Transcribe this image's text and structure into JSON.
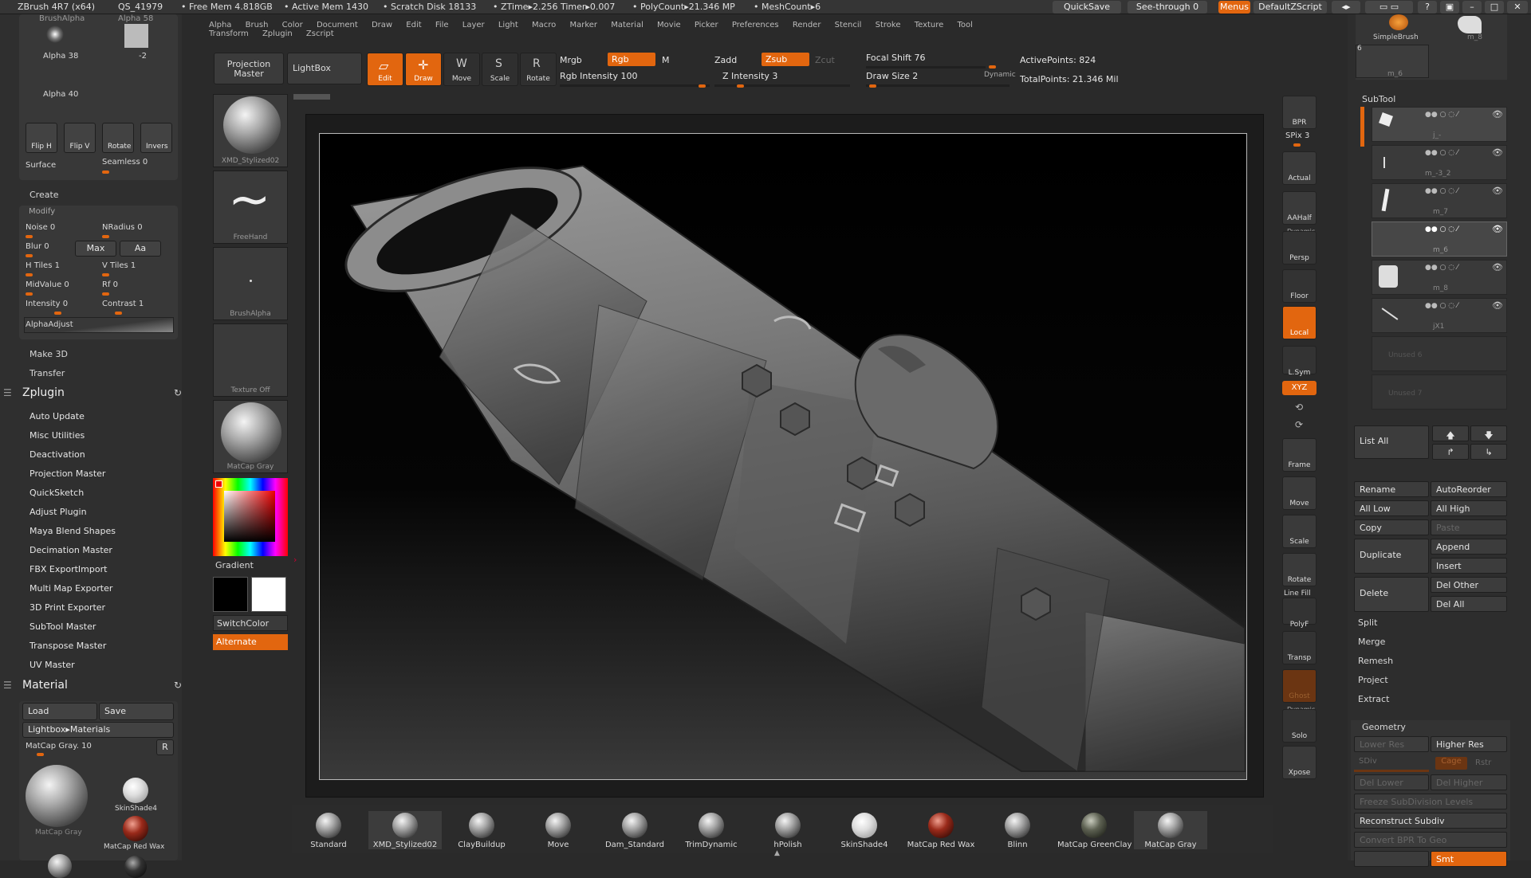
{
  "titlebar": {
    "app": "ZBrush 4R7 (x64)",
    "qs": "QS_41979",
    "free_mem": "• Free Mem 4.818GB",
    "active_mem": "• Active Mem 1430",
    "scratch": "• Scratch Disk 18133",
    "ztime": "• ZTime▸2.256 Timer▸0.007",
    "polycount": "• PolyCount▸21.346 MP",
    "meshcount": "• MeshCount▸6",
    "quicksave": "QuickSave",
    "see_through": "See-through  0",
    "menus": "Menus",
    "default_zscript": "DefaultZScript"
  },
  "menubar": [
    "Alpha",
    "Brush",
    "Color",
    "Document",
    "Draw",
    "Edit",
    "File",
    "Layer",
    "Light",
    "Macro",
    "Marker",
    "Material",
    "Movie",
    "Picker",
    "Preferences",
    "Render",
    "Stencil",
    "Stroke",
    "Texture",
    "Tool",
    "Transform",
    "Zplugin",
    "Zscript"
  ],
  "toolbar": {
    "projection_master": "Projection Master",
    "lightbox": "LightBox",
    "edit": "Edit",
    "draw": "Draw",
    "move": "Move",
    "scale": "Scale",
    "rotate": "Rotate",
    "mrgb": "Mrgb",
    "rgb": "Rgb",
    "m": "M",
    "rgb_intensity": "Rgb Intensity 100",
    "zadd": "Zadd",
    "zsub": "Zsub",
    "zcut": "Zcut",
    "z_intensity": "Z Intensity 3",
    "focal_shift": "Focal Shift 76",
    "draw_size": "Draw Size 2",
    "dynamic": "Dynamic",
    "active_points": "ActivePoints: 824",
    "total_points": "TotalPoints: 21.346 Mil"
  },
  "alpha_panel": {
    "brush_alpha": "BrushAlpha",
    "alpha58": "Alpha 58",
    "alpha38": "Alpha 38",
    "neg2": "-2",
    "alpha40": "Alpha 40",
    "flip_h": "Flip H",
    "flip_v": "Flip V",
    "rotate": "Rotate",
    "invers": "Invers",
    "surface": "Surface",
    "seamless": "Seamless 0",
    "create": "Create",
    "modify": "Modify",
    "noise": "Noise 0",
    "nradius": "NRadius 0",
    "blur": "Blur 0",
    "max": "Max",
    "aa": "Aa",
    "h_tiles": "H Tiles 1",
    "v_tiles": "V Tiles 1",
    "midvalue": "MidValue 0",
    "rf": "Rf 0",
    "intensity": "Intensity 0",
    "contrast": "Contrast 1",
    "alpha_adjust": "AlphaAdjust",
    "make3d": "Make 3D",
    "transfer": "Transfer"
  },
  "zplugin": {
    "header": "Zplugin",
    "items": [
      "Auto Update",
      "Misc Utilities",
      "Deactivation",
      "Projection Master",
      "QuickSketch",
      "Adjust Plugin",
      "Maya Blend Shapes",
      "Decimation Master",
      "FBX ExportImport",
      "Multi Map Exporter",
      "3D Print Exporter",
      "SubTool Master",
      "Transpose Master",
      "UV Master"
    ]
  },
  "material": {
    "header": "Material",
    "load": "Load",
    "save": "Save",
    "lightbox_materials": "Lightbox▸Materials",
    "matcap_gray": "MatCap Gray. 10",
    "r": "R",
    "big_caption": "MatCap Gray",
    "skinshade": "SkinShade4",
    "redwax": "MatCap Red Wax"
  },
  "shelf": {
    "brush": "XMD_Stylized02",
    "stroke": "FreeHand",
    "alpha": "BrushAlpha",
    "texture": "Texture Off",
    "material": "MatCap Gray",
    "gradient": "Gradient",
    "switchcolor": "SwitchColor",
    "alternate": "Alternate"
  },
  "right_shelf": [
    "BPR",
    "SPix 3",
    "Actual",
    "AAHalf",
    "Persp",
    "Floor",
    "Local",
    "L.Sym",
    "XYZ",
    "Frame",
    "Move",
    "Scale",
    "Rotate",
    "PolyF",
    "Transp",
    "Ghost",
    "Solo",
    "Xpose"
  ],
  "right_shelf_extra": {
    "dynamic": "Dynamic",
    "line_fill": "Line Fill",
    "dynamic2": "Dynamic"
  },
  "subtool": {
    "simplebrush": "SimpleBrush",
    "m8": "m_8",
    "six": "6",
    "m6": "m_6",
    "header": "SubTool",
    "rows": [
      "j_-",
      "m_-3_2",
      "m_7",
      "m_6",
      "m_8",
      "jX1"
    ],
    "unused": [
      "Unused 6",
      "Unused 7"
    ],
    "list_all": "List All",
    "rename": "Rename",
    "autoreorder": "AutoReorder",
    "all_low": "All Low",
    "all_high": "All High",
    "copy": "Copy",
    "paste": "Paste",
    "duplicate": "Duplicate",
    "append": "Append",
    "insert": "Insert",
    "delete": "Delete",
    "del_other": "Del Other",
    "del_all": "Del All",
    "split": "Split",
    "merge": "Merge",
    "remesh": "Remesh",
    "project": "Project",
    "extract": "Extract"
  },
  "geometry": {
    "header": "Geometry",
    "lower_res": "Lower Res",
    "higher_res": "Higher Res",
    "sdiv": "SDiv",
    "cage": "Cage",
    "rstr": "Rstr",
    "del_lower": "Del Lower",
    "del_higher": "Del Higher",
    "freeze": "Freeze SubDivision Levels",
    "reconstruct": "Reconstruct Subdiv",
    "convert_bpr": "Convert BPR To Geo",
    "smt": "Smt"
  },
  "materials_bar": [
    "Standard",
    "XMD_Stylized02",
    "ClayBuildup",
    "Move",
    "Dam_Standard",
    "TrimDynamic",
    "hPolish",
    "SkinShade4",
    "MatCap Red Wax",
    "Blinn",
    "MatCap GreenClay",
    "MatCap Gray"
  ],
  "colors": {
    "accent": "#e2660f",
    "panel": "#2f2f2f"
  }
}
